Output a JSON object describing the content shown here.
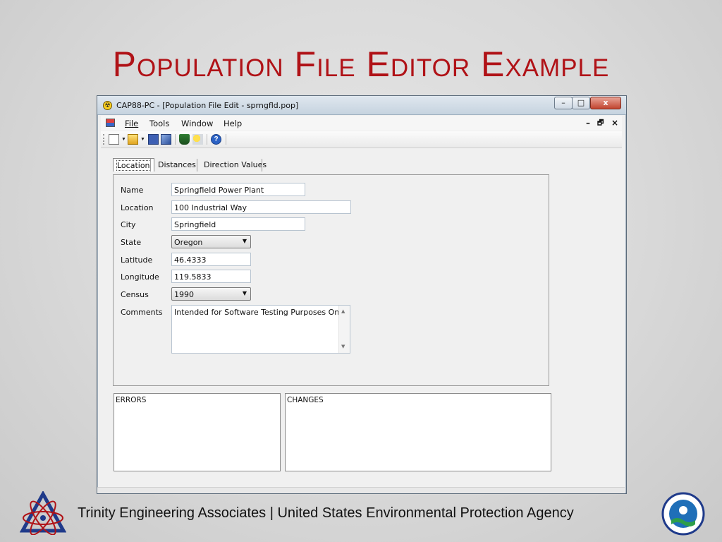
{
  "slide": {
    "title": "Population File Editor Example",
    "footer": "Trinity Engineering Associates | United States Environmental Protection Agency"
  },
  "window": {
    "title": "CAP88-PC - [Population File Edit - sprngfld.pop]",
    "min_label": "–",
    "max_label": "□",
    "close_label": "x"
  },
  "menu": {
    "items": [
      "File",
      "Tools",
      "Window",
      "Help"
    ],
    "mdi_min": "–",
    "mdi_restore": "🗗",
    "mdi_close": "×"
  },
  "tabs": [
    "Location",
    "Distances",
    "Direction Values"
  ],
  "form": {
    "labels": {
      "name": "Name",
      "location": "Location",
      "city": "City",
      "state": "State",
      "latitude": "Latitude",
      "longitude": "Longitude",
      "census": "Census",
      "comments": "Comments"
    },
    "values": {
      "name": "Springfield Power Plant",
      "location": "100 Industrial Way",
      "city": "Springfield",
      "state": "Oregon",
      "latitude": "46.4333",
      "longitude": "119.5833",
      "census": "1990",
      "comments": "Intended for Software Testing Purposes Only"
    }
  },
  "panels": {
    "errors": "ERRORS",
    "changes": "CHANGES"
  },
  "colors": {
    "title": "#b01217"
  }
}
